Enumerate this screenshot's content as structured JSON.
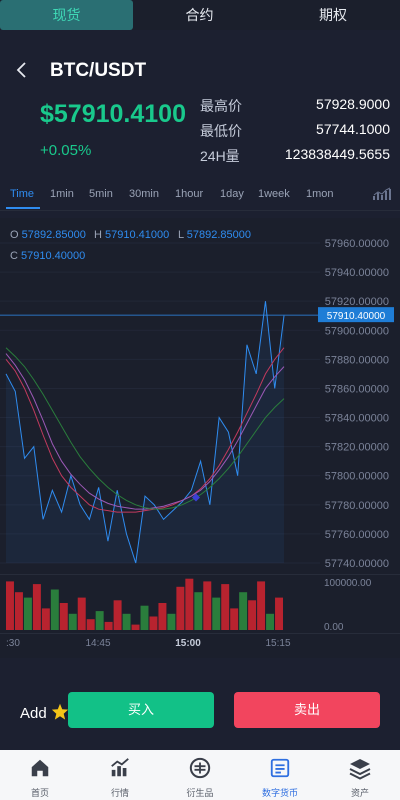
{
  "top_tabs": [
    "现货",
    "合约",
    "期权"
  ],
  "pair": "BTC/USDT",
  "last_price": "$57910.4100",
  "change": "+0.05%",
  "stats": [
    {
      "label": "最高价",
      "value": "57928.9000"
    },
    {
      "label": "最低价",
      "value": "57744.1000"
    },
    {
      "label": "24H量",
      "value": "123838449.5655"
    }
  ],
  "timeframes": [
    "Time",
    "1min",
    "5min",
    "30min",
    "1hour",
    "1day",
    "1week",
    "1mon"
  ],
  "ohlc": {
    "o_label": "O",
    "o": "57892.85000",
    "h_label": "H",
    "h": "57910.41000",
    "l_label": "L",
    "l": "57892.85000",
    "c_label": "C",
    "c": "57910.40000"
  },
  "chart_data": {
    "type": "line",
    "price_axis_ticks": [
      "57960.00000",
      "57940.00000",
      "57920.00000",
      "57900.00000",
      "57880.00000",
      "57860.00000",
      "57840.00000",
      "57820.00000",
      "57800.00000",
      "57780.00000",
      "57760.00000",
      "57740.00000"
    ],
    "price_axis_values": [
      57960,
      57940,
      57920,
      57900,
      57880,
      57860,
      57840,
      57820,
      57800,
      57780,
      57760,
      57740
    ],
    "current_price_label": "57910.40000",
    "current_price": 57910.4,
    "volume_axis_ticks": [
      "100000.00",
      "0.00"
    ],
    "x_ticks": [
      ":30",
      "14:45",
      "15:00",
      "15:15"
    ],
    "series": [
      {
        "values": [
          57870,
          57858,
          57812,
          57820,
          57770,
          57790,
          57775,
          57800,
          57780,
          57770,
          57792,
          57755,
          57790,
          57760,
          57740,
          57786,
          57780,
          57770,
          57776,
          57782,
          57790,
          57810,
          57780,
          57840,
          57830,
          57800,
          57890,
          57870,
          57920,
          57860,
          57910
        ]
      },
      {
        "values": [
          57880,
          57872,
          57860,
          57845,
          57828,
          57812,
          57800,
          57792,
          57786,
          57780,
          57777,
          57776,
          57775,
          57775,
          57775,
          57776,
          57777,
          57778,
          57780,
          57783,
          57786,
          57791,
          57798,
          57807,
          57818,
          57830,
          57843,
          57856,
          57870,
          57880,
          57888
        ]
      },
      {
        "values": [
          57884,
          57876,
          57866,
          57853,
          57838,
          57822,
          57810,
          57801,
          57794,
          57788,
          57784,
          57781,
          57779,
          57778,
          57777,
          57777,
          57778,
          57779,
          57781,
          57783,
          57786,
          57790,
          57796,
          57804,
          57813,
          57824,
          57836,
          57848,
          57860,
          57868,
          57875
        ]
      },
      {
        "values": [
          57888,
          57882,
          57875,
          57866,
          57856,
          57845,
          57834,
          57823,
          57813,
          57805,
          57798,
          57792,
          57787,
          57783,
          57780,
          57778,
          57777,
          57777,
          57778,
          57780,
          57783,
          57787,
          57792,
          57798,
          57805,
          57813,
          57822,
          57831,
          57840,
          57847,
          57853
        ]
      }
    ],
    "volume_bars": [
      0.9,
      0.7,
      0.6,
      0.85,
      0.4,
      0.75,
      0.5,
      0.3,
      0.6,
      0.2,
      0.35,
      0.15,
      0.55,
      0.3,
      0.1,
      0.45,
      0.25,
      0.5,
      0.3,
      0.8,
      0.95,
      0.7,
      0.9,
      0.6,
      0.85,
      0.4,
      0.7,
      0.55,
      0.9,
      0.3,
      0.6
    ],
    "volume_colors": [
      "#b8232f",
      "#b8232f",
      "#2a7d3c",
      "#b8232f",
      "#b8232f",
      "#2a7d3c",
      "#b8232f",
      "#2a7d3c",
      "#b8232f",
      "#b8232f",
      "#2a7d3c",
      "#b8232f",
      "#b8232f",
      "#2a7d3c",
      "#b8232f",
      "#2a7d3c",
      "#b8232f",
      "#b8232f",
      "#2a7d3c",
      "#b8232f",
      "#b8232f",
      "#2a7d3c",
      "#b8232f",
      "#2a7d3c",
      "#b8232f",
      "#b8232f",
      "#2a7d3c",
      "#b8232f",
      "#b8232f",
      "#2a7d3c",
      "#b8232f"
    ]
  },
  "actions": {
    "add_label": "Add",
    "buy": "买入",
    "sell": "卖出"
  },
  "bottom_tabs": [
    "首页",
    "行情",
    "衍生品",
    "数字货币",
    "资产"
  ],
  "colors": {
    "up": "#19c98c",
    "down": "#f2455e",
    "accent": "#2f8cf0"
  }
}
